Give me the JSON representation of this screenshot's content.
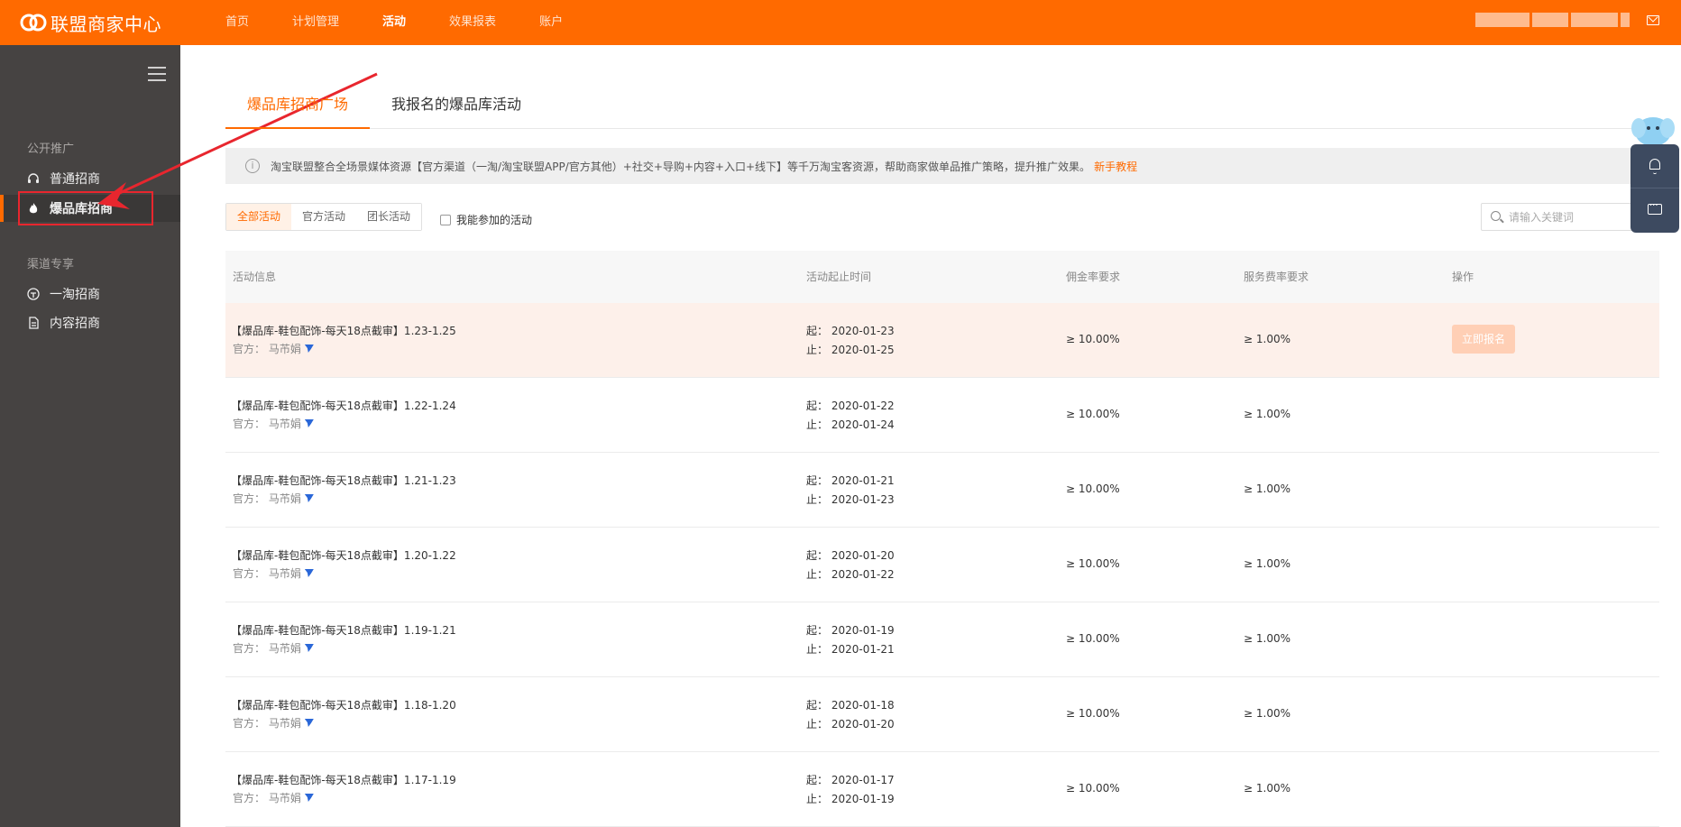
{
  "header": {
    "app_title": "联盟商家中心",
    "nav": [
      {
        "label": "首页",
        "active": false
      },
      {
        "label": "计划管理",
        "active": false
      },
      {
        "label": "活动",
        "active": true
      },
      {
        "label": "效果报表",
        "active": false
      },
      {
        "label": "账户",
        "active": false
      }
    ],
    "brand_color": "#ff6a00"
  },
  "sidebar": {
    "sections": [
      {
        "title": "公开推广",
        "items": [
          {
            "label": "普通招商",
            "icon": "headset-icon",
            "active": false
          },
          {
            "label": "爆品库招商",
            "icon": "fire-icon",
            "active": true
          }
        ]
      },
      {
        "title": "渠道专享",
        "items": [
          {
            "label": "一淘招商",
            "icon": "yitao-icon",
            "active": false
          },
          {
            "label": "内容招商",
            "icon": "document-icon",
            "active": false
          }
        ]
      }
    ]
  },
  "main": {
    "tabs": [
      {
        "label": "爆品库招商广场",
        "active": true
      },
      {
        "label": "我报名的爆品库活动",
        "active": false
      }
    ],
    "notice": {
      "text": "淘宝联盟整合全场景媒体资源【官方渠道（一淘/淘宝联盟APP/官方其他）+社交+导购+内容+入口+线下】等千万淘宝客资源，帮助商家做单品推广策略，提升推广效果。",
      "link": "新手教程"
    },
    "filters": [
      {
        "label": "全部活动",
        "active": true
      },
      {
        "label": "官方活动",
        "active": false
      },
      {
        "label": "团长活动",
        "active": false
      }
    ],
    "checkbox_label": "我能参加的活动",
    "search": {
      "placeholder": "请输入关键词",
      "value": ""
    },
    "table": {
      "columns": [
        "活动信息",
        "活动起止时间",
        "佣金率要求",
        "服务费率要求",
        "操作"
      ],
      "start_prefix": "起：",
      "end_prefix": "止：",
      "action_label": "立即报名",
      "rows": [
        {
          "title": "【爆品库-鞋包配饰-每天18点截审】1.23-1.25",
          "org": "官方： 马芇娟",
          "start": "2020-01-23",
          "end": "2020-01-25",
          "commission": "≥ 10.00%",
          "service": "≥ 1.00%",
          "hover": true
        },
        {
          "title": "【爆品库-鞋包配饰-每天18点截审】1.22-1.24",
          "org": "官方： 马芇娟",
          "start": "2020-01-22",
          "end": "2020-01-24",
          "commission": "≥ 10.00%",
          "service": "≥ 1.00%",
          "hover": false
        },
        {
          "title": "【爆品库-鞋包配饰-每天18点截审】1.21-1.23",
          "org": "官方： 马芇娟",
          "start": "2020-01-21",
          "end": "2020-01-23",
          "commission": "≥ 10.00%",
          "service": "≥ 1.00%",
          "hover": false
        },
        {
          "title": "【爆品库-鞋包配饰-每天18点截审】1.20-1.22",
          "org": "官方： 马芇娟",
          "start": "2020-01-20",
          "end": "2020-01-22",
          "commission": "≥ 10.00%",
          "service": "≥ 1.00%",
          "hover": false
        },
        {
          "title": "【爆品库-鞋包配饰-每天18点截审】1.19-1.21",
          "org": "官方： 马芇娟",
          "start": "2020-01-19",
          "end": "2020-01-21",
          "commission": "≥ 10.00%",
          "service": "≥ 1.00%",
          "hover": false
        },
        {
          "title": "【爆品库-鞋包配饰-每天18点截审】1.18-1.20",
          "org": "官方： 马芇娟",
          "start": "2020-01-18",
          "end": "2020-01-20",
          "commission": "≥ 10.00%",
          "service": "≥ 1.00%",
          "hover": false
        },
        {
          "title": "【爆品库-鞋包配饰-每天18点截审】1.17-1.19",
          "org": "官方： 马芇娟",
          "start": "2020-01-17",
          "end": "2020-01-19",
          "commission": "≥ 10.00%",
          "service": "≥ 1.00%",
          "hover": false
        }
      ]
    }
  },
  "float_widgets": [
    {
      "icon": "bell-icon"
    },
    {
      "icon": "chat-icon"
    }
  ],
  "annotation": {
    "color": "#e8262e"
  }
}
